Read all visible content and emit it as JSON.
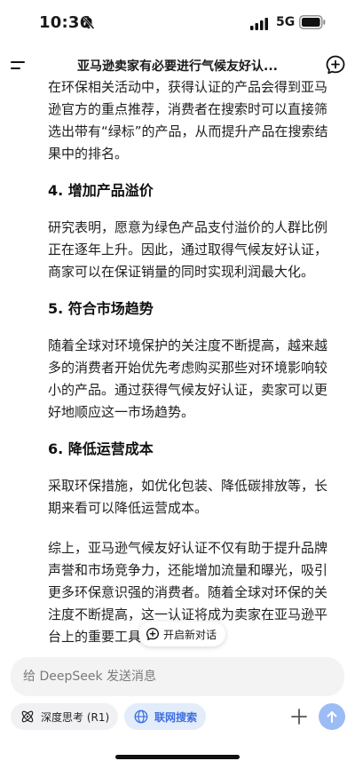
{
  "status_bar": {
    "time": "10:36",
    "network": "5G"
  },
  "header": {
    "title": "亚马逊卖家有必要进行气候友好认..."
  },
  "content": {
    "p1": "在环保相关活动中，获得认证的产品会得到亚马逊官方的重点推荐，消费者在搜索时可以直接筛选出带有“绿标”的产品，从而提升产品在搜索结果中的排名。",
    "h4": "4. 增加产品溢价",
    "p2": "研究表明，愿意为绿色产品支付溢价的人群比例正在逐年上升。因此，通过取得气候友好认证，商家可以在保证销量的同时实现利润最大化。",
    "h5": "5. 符合市场趋势",
    "p3": "随着全球对环境保护的关注度不断提高，越来越多的消费者开始优先考虑购买那些对环境影响较小的产品。通过获得气候友好认证，卖家可以更好地顺应这一市场趋势。",
    "h6": "6. 降低运营成本",
    "p4": "采取环保措施，如优化包装、降低碳排放等，长期来看可以降低运营成本。",
    "p5": "综上，亚马逊气候友好认证不仅有助于提升品牌声誉和市场竞争力，还能增加流量和曝光，吸引更多环保意识强的消费者。随着全球对环保的关注度不断提高，这一认证将成为卖家在亚马逊平台上的重要工具。"
  },
  "floating": {
    "new_chat_label": "开启新对话"
  },
  "input": {
    "placeholder": "给 DeepSeek 发送消息",
    "deepthink_label": "深度思考 (R1)",
    "search_label": "联网搜索"
  },
  "colors": {
    "accent": "#3d6fe0",
    "search_chip_bg": "#e3ecfb",
    "send_button": "#9bbcf5",
    "input_bg": "#f3f3f4"
  },
  "icons": {
    "status": [
      "silent-bell-icon",
      "signal-icon",
      "battery-icon"
    ],
    "header": [
      "menu-icon",
      "new-chat-icon"
    ],
    "input": [
      "atom-icon",
      "globe-icon",
      "plus-icon",
      "arrow-up-icon"
    ]
  }
}
